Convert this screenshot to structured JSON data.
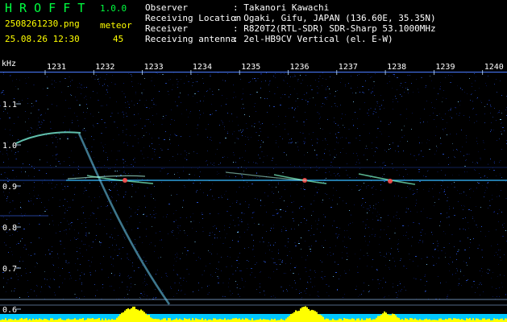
{
  "header": {
    "app_title": "H R O F F T",
    "version": "1.0.0",
    "filename": "2508261230.png",
    "mode_label": "meteor",
    "timestamp": "25.08.26 12:30",
    "count": "45"
  },
  "info": [
    {
      "label": "Observer",
      "value": ": Takanori Kawachi"
    },
    {
      "label": "Receiving Location",
      "value": ": Ogaki, Gifu, JAPAN (136.60E, 35.35N)"
    },
    {
      "label": "Receiver",
      "value": ": R820T2(RTL-SDR) SDR-Sharp 53.1000MHz"
    },
    {
      "label": "Receiving antenna",
      "value": ": 2el-HB9CV Vertical (el. E-W)"
    }
  ],
  "axis": {
    "y_unit": "kHz",
    "y_ticks": [
      "1.1",
      "1.0",
      "0.9",
      "0.8",
      "0.7",
      "0.6"
    ],
    "x_ticks": [
      "1231",
      "1232",
      "1233",
      "1234",
      "1235",
      "1236",
      "1237",
      "1238",
      "1239",
      "1240"
    ]
  },
  "colors": {
    "background": "#000000",
    "noise_dim": "#0c1d6e",
    "noise_mid": "#2a55d8",
    "noise_bright": "#7fd0ff",
    "carrier": "#39c8ff",
    "echo_core": "#ff5050",
    "trace": "#80ffe6",
    "power_fill": "#ffff00",
    "power_base": "#00c8ff",
    "text_yellow": "#ffff00",
    "text_white": "#ffffff",
    "text_green": "#00ff40"
  }
}
